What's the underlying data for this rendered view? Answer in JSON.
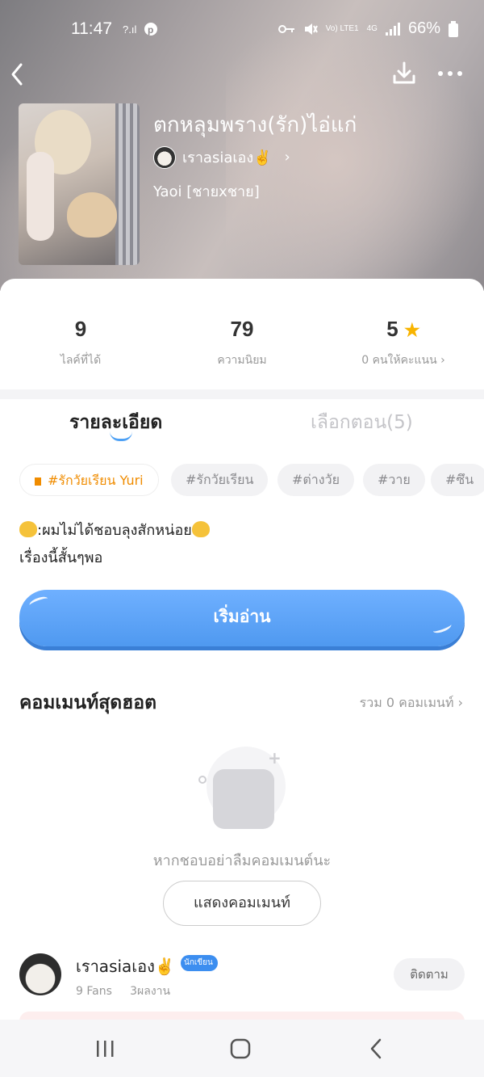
{
  "status_bar": {
    "time": "11:47",
    "battery": "66%",
    "net_lte": "Vo) LTE1",
    "net_4g": "4G"
  },
  "book": {
    "title": "ตกหลุมพราง(รัก)ไอ่แก่",
    "author": "เราasiaเอง✌️",
    "genre": "Yaoi [ชายxชาย]"
  },
  "stats": {
    "likes": {
      "value": "9",
      "label": "ไลค์ที่ได้"
    },
    "popularity": {
      "value": "79",
      "label": "ความนิยม"
    },
    "rating": {
      "value": "5",
      "label": "0 คนให้คะแนน"
    }
  },
  "tabs": {
    "details": "รายละเอียด",
    "episodes": "เลือกตอน(5)"
  },
  "tags": [
    "#รักวัยเรียน Yuri",
    "#รักวัยเรียน",
    "#ต่างวัย",
    "#วาย",
    "#ซึน"
  ],
  "synopsis": {
    "line1": ":ผมไม่ได้ชอบลุงสักหน่อย",
    "line2": "เรื่องนี้สั้นๆพอ"
  },
  "read_button": "เริ่มอ่าน",
  "comments": {
    "title": "คอมเมนท์สุดฮอต",
    "total": "รวม 0 คอมเมนท์",
    "empty_text": "หากชอบอย่าลืมคอมเมนต์นะ",
    "show_button": "แสดงคอมเมนท์"
  },
  "author_card": {
    "name": "เราasiaเอง✌️",
    "badge": "นักเขียน",
    "fans": "9 Fans",
    "works": "3ผลงาน",
    "follow_button": "ติดตาม"
  },
  "icons": {
    "back": "chevron-left-icon",
    "download": "download-icon",
    "more": "more-dots-icon",
    "star": "star-icon"
  },
  "colors": {
    "accent_blue": "#4f99f0",
    "tag_orange": "#f08c00",
    "star_yellow": "#f8b400"
  }
}
